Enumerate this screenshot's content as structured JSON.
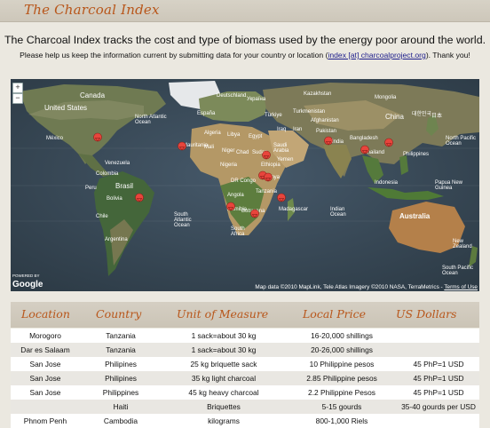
{
  "header": {
    "title": "The Charcoal Index"
  },
  "intro": {
    "headline": "The Charcoal Index tracks the cost and type of biomass used by the energy poor around the world.",
    "help_before": "Please help us keep the information current by submitting data for your country or location (",
    "help_link": "index [at] charcoalproject.org",
    "help_after": "). Thank you!"
  },
  "map": {
    "zoom_in": "+",
    "zoom_out": "−",
    "attribution": "Map data ©2010 MapLink, Tele Atlas Imagery ©2010 NASA, TerraMetrics - ",
    "terms": "Terms of Use",
    "powered_by": "POWERED BY",
    "brand": "Google",
    "labels": {
      "canada": "Canada",
      "united_states": "United States",
      "mexico": "México",
      "north_atlantic": "North Atlantic Ocean",
      "venezuela": "Venezuela",
      "colombia": "Colombia",
      "peru": "Peru",
      "brasil": "Brasil",
      "bolivia": "Bolivia",
      "chile": "Chile",
      "argentina": "Argentina",
      "south_atlantic": "South Atlantic Ocean",
      "algeria": "Algeria",
      "libya": "Libya",
      "egypt": "Egypt",
      "mali": "Mali",
      "niger": "Niger",
      "chad": "Chad",
      "sudan": "Sudan",
      "mauritania": "Mauritania",
      "nigeria": "Nigeria",
      "ethiopia": "Ethiopia",
      "kenya": "Kenya",
      "dr_congo": "DR Congo",
      "tanzania": "Tanzania",
      "angola": "Angola",
      "namibia": "Namibia",
      "botswana": "Botswana",
      "south_africa": "South Africa",
      "madagascar": "Madagascar",
      "indian_ocean": "Indian Ocean",
      "saudi_arabia": "Saudi Arabia",
      "iran": "Iran",
      "iraq": "Iraq",
      "turkey": "Türkiye",
      "india": "India",
      "kazakhstan": "Kazakhstan",
      "china": "China",
      "mongolia": "Mongolia",
      "deutschland": "Deutschland",
      "espana": "España",
      "ukraine": "Україна",
      "japan": "日本",
      "korea": "대한민국",
      "thailand": "Thailand",
      "indonesia": "Indonesia",
      "australia": "Australia",
      "new_zealand": "New Zealand",
      "yemen": "Yemen",
      "afghanistan": "Afghanistan",
      "turkmenistan": "Turkmenistan",
      "pakistan": "Pakistan",
      "bangladesh": "Bangladesh",
      "philippines": "Philippines",
      "papua": "Papua New Guinea",
      "south_pacific": "South Pacific Ocean",
      "north_pacific": "North Pacific Ocean"
    }
  },
  "table": {
    "headers": [
      "Location",
      "Country",
      "Unit of Measure",
      "Local Price",
      "US Dollars"
    ],
    "rows": [
      [
        "Morogoro",
        "Tanzania",
        "1 sack=about 30 kg",
        "16-20,000 shillings",
        ""
      ],
      [
        "Dar es Salaam",
        "Tanzania",
        "1 sack=about 30 kg",
        "20-26,000 shillings",
        ""
      ],
      [
        "San Jose",
        "Philipines",
        "25 kg briquette sack",
        "10 Philippine pesos",
        "45 PhP=1 USD"
      ],
      [
        "San Jose",
        "Philipines",
        "35 kg light charcoal",
        "2.85 Philippine pesos",
        "45 PhP=1 USD"
      ],
      [
        "San Jose",
        "Philippines",
        "45 kg heavy charcoal",
        "2.2 Philippine Pesos",
        "45 PhP=1 USD"
      ],
      [
        "",
        "Haiti",
        "Briquettes",
        "5-15 gourds",
        "35-40 gourds per USD"
      ],
      [
        "Phnom Penh",
        "Cambodia",
        "kilograms",
        "800-1,000 Riels",
        ""
      ]
    ]
  },
  "colors": {
    "accent": "#b8561a",
    "ocean": "#3a4b56",
    "marker": "#e8453c"
  }
}
